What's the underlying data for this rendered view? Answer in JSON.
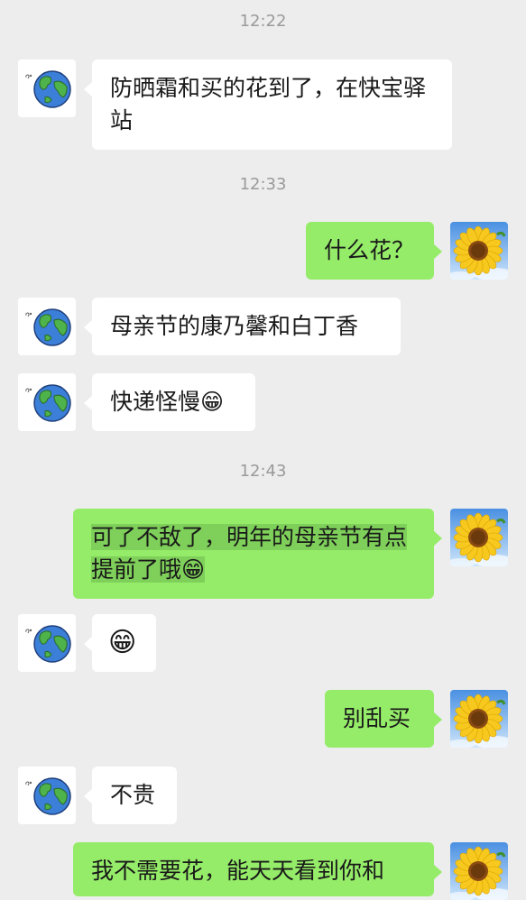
{
  "messages": [
    {
      "type": "time",
      "text": "12:22"
    },
    {
      "type": "in",
      "text": "防晒霜和买的花到了，在快宝驿站"
    },
    {
      "type": "time",
      "text": "12:33"
    },
    {
      "type": "out",
      "text": "什么花？"
    },
    {
      "type": "in",
      "text": "母亲节的康乃馨和白丁香"
    },
    {
      "type": "in",
      "text": "快递怪慢😁"
    },
    {
      "type": "time",
      "text": "12:43"
    },
    {
      "type": "out",
      "text": "可了不敌了，明年的母亲节有点提前了哦😁"
    },
    {
      "type": "in",
      "text": "😁"
    },
    {
      "type": "out",
      "text": "别乱买"
    },
    {
      "type": "in",
      "text": "不贵"
    },
    {
      "type": "out",
      "text": "我不需要花，能天天看到你和"
    }
  ],
  "avatars": {
    "contact": "earth-avatar-icon",
    "self": "sunflower-avatar-icon"
  },
  "colors": {
    "background": "#ededed",
    "incoming_bubble": "#ffffff",
    "outgoing_bubble": "#95ec69",
    "timestamp": "#9a9a9a"
  }
}
